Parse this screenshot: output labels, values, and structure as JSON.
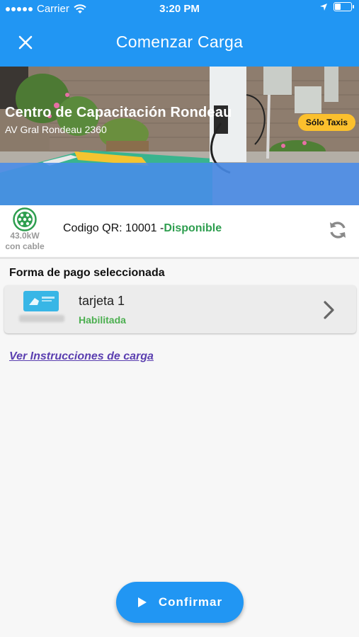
{
  "status_bar": {
    "carrier": "Carrier",
    "time": "3:20 PM"
  },
  "header": {
    "title": "Comenzar Carga"
  },
  "station": {
    "name": "Centro de Capacitación Rondeau",
    "address": "AV Gral Rondeau 2360",
    "badge": "Sólo Taxis"
  },
  "connector": {
    "power": "43.0kW",
    "cable": "con cable",
    "qr_label": "Codigo QR: 10001 -",
    "status": "Disponible"
  },
  "payment": {
    "heading": "Forma de pago seleccionada",
    "card_name": "tarjeta 1",
    "card_status": "Habilitada"
  },
  "links": {
    "instructions": "Ver Instrucciones de carga"
  },
  "actions": {
    "confirm": "Confirmar"
  },
  "colors": {
    "primary": "#2196f3",
    "available": "#2e9e4f",
    "enabled": "#4caf50",
    "badge": "#fbc02d",
    "link": "#5b3fb0"
  }
}
